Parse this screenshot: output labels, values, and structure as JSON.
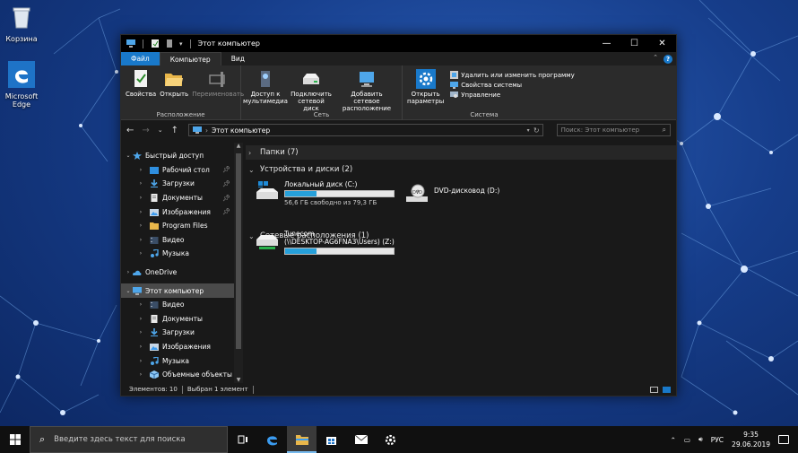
{
  "desktop": {
    "icons": [
      {
        "label": "Корзина",
        "icon": "recycle-bin-icon"
      },
      {
        "label": "Microsoft Edge",
        "icon": "edge-icon"
      }
    ]
  },
  "window": {
    "title": "Этот компьютер",
    "controls": {
      "minimize": "—",
      "maximize": "☐",
      "close": "✕"
    }
  },
  "ribbon_tabs": [
    {
      "label": "Файл"
    },
    {
      "label": "Компьютер"
    },
    {
      "label": "Вид"
    }
  ],
  "ribbon": {
    "groups": [
      {
        "label": "Расположение",
        "buttons": [
          {
            "label": "Свойства",
            "icon": "properties-icon"
          },
          {
            "label": "Открыть",
            "icon": "open-folder-icon"
          },
          {
            "label": "Переименовать",
            "icon": "rename-icon",
            "disabled": true
          }
        ]
      },
      {
        "label": "Сеть",
        "buttons": [
          {
            "label": "Доступ к мультимедиа",
            "icon": "media-access-icon"
          },
          {
            "label": "Подключить сетевой диск",
            "icon": "map-network-drive-icon"
          },
          {
            "label": "Добавить сетевое расположение",
            "icon": "add-network-location-icon"
          }
        ]
      },
      {
        "label": "Система",
        "buttons": [
          {
            "label": "Открыть параметры",
            "icon": "settings-icon"
          }
        ],
        "small": [
          {
            "label": "Удалить или изменить программу",
            "icon": "uninstall-icon"
          },
          {
            "label": "Свойства системы",
            "icon": "system-properties-icon"
          },
          {
            "label": "Управление",
            "icon": "manage-icon"
          }
        ]
      }
    ],
    "help": "?"
  },
  "address": {
    "path": "Этот компьютер",
    "search_placeholder": "Поиск: Этот компьютер"
  },
  "nav_pane": {
    "items": [
      {
        "label": "Быстрый доступ",
        "level": 0,
        "expanded": true,
        "icon": "star-icon"
      },
      {
        "label": "Рабочий стол",
        "level": 1,
        "pinned": true,
        "icon": "desktop-folder-icon"
      },
      {
        "label": "Загрузки",
        "level": 1,
        "pinned": true,
        "icon": "downloads-icon"
      },
      {
        "label": "Документы",
        "level": 1,
        "pinned": true,
        "icon": "documents-icon"
      },
      {
        "label": "Изображения",
        "level": 1,
        "pinned": true,
        "icon": "pictures-icon"
      },
      {
        "label": "Program Files",
        "level": 1,
        "icon": "folder-icon"
      },
      {
        "label": "Видео",
        "level": 1,
        "icon": "video-icon"
      },
      {
        "label": "Музыка",
        "level": 1,
        "icon": "music-icon"
      },
      {
        "label": "OneDrive",
        "level": 0,
        "icon": "onedrive-icon"
      },
      {
        "label": "Этот компьютер",
        "level": 0,
        "expanded": true,
        "selected": true,
        "icon": "computer-icon"
      },
      {
        "label": "Видео",
        "level": 1,
        "icon": "video-icon"
      },
      {
        "label": "Документы",
        "level": 1,
        "icon": "documents-icon"
      },
      {
        "label": "Загрузки",
        "level": 1,
        "icon": "downloads-icon"
      },
      {
        "label": "Изображения",
        "level": 1,
        "icon": "pictures-icon"
      },
      {
        "label": "Музыка",
        "level": 1,
        "icon": "music-icon"
      },
      {
        "label": "Объемные объекты",
        "level": 1,
        "icon": "3d-objects-icon"
      }
    ]
  },
  "content": {
    "sections": [
      {
        "label": "Папки (7)",
        "expanded": false
      },
      {
        "label": "Устройства и диски (2)",
        "expanded": true
      },
      {
        "label": "Сетевые расположения (1)",
        "expanded": true
      }
    ],
    "drives": [
      {
        "name": "Локальный диск (C:)",
        "free": "56,6 ГБ свободно из 79,3 ГБ",
        "used_fraction": 0.29,
        "icon": "local-disk-icon"
      },
      {
        "name": "DVD-дисковод (D:)",
        "icon": "dvd-drive-icon"
      }
    ],
    "network": [
      {
        "name": "Tunecom",
        "path": "(\\\\DESKTOP-AG6FNA3\\Users) (Z:)",
        "used_fraction": 0.29,
        "icon": "network-drive-icon"
      }
    ]
  },
  "status": {
    "items": "Элементов: 10",
    "selected": "Выбран 1 элемент"
  },
  "taskbar": {
    "search_placeholder": "Введите здесь текст для поиска",
    "apps": [
      {
        "name": "task-view-icon"
      },
      {
        "name": "edge-icon"
      },
      {
        "name": "file-explorer-icon",
        "active": true
      },
      {
        "name": "store-icon"
      },
      {
        "name": "mail-icon"
      },
      {
        "name": "settings-icon"
      }
    ],
    "lang": "РУС",
    "time": "9:35",
    "date": "29.06.2019"
  },
  "colors": {
    "accent": "#1979ca",
    "progress": "#26a0da",
    "window_bg": "#191919",
    "ribbon_bg": "#2b2b2b"
  }
}
